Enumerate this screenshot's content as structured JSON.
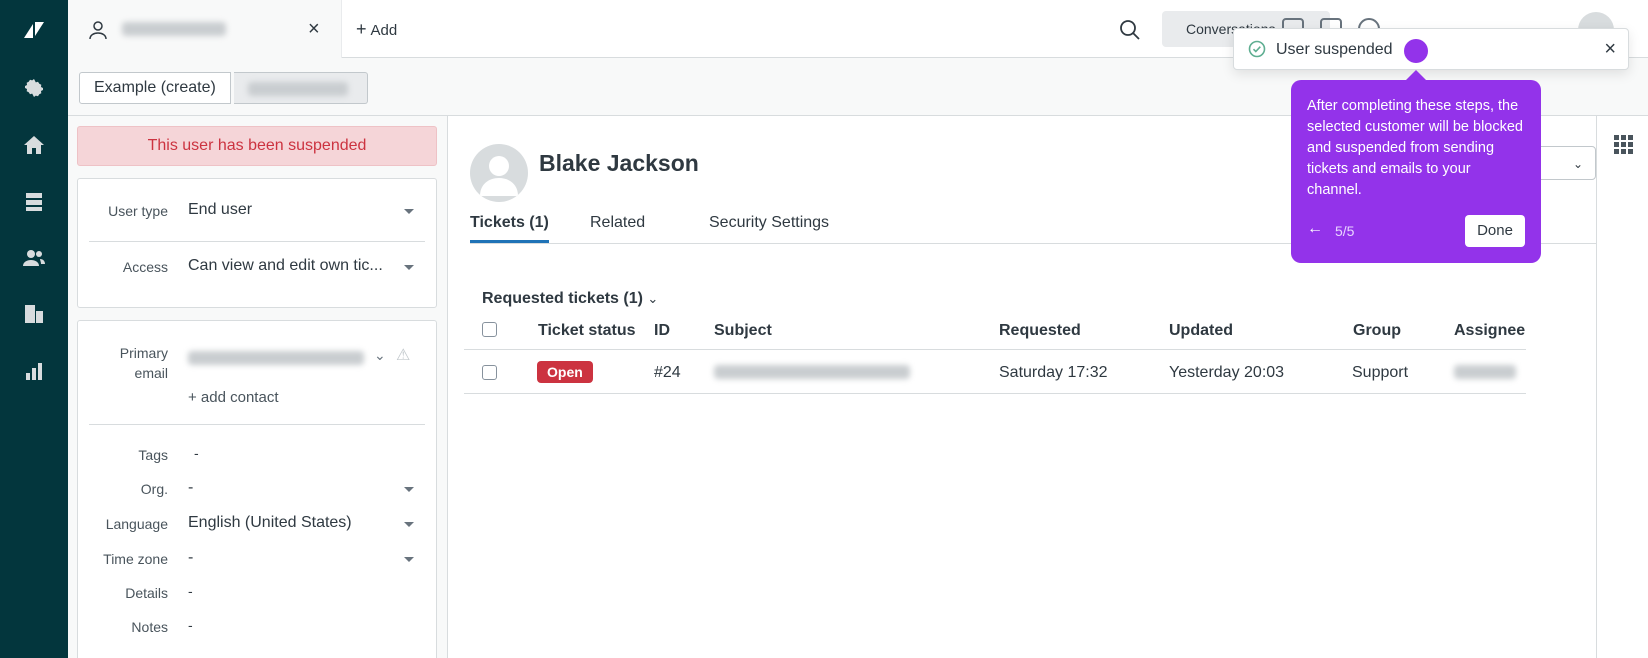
{
  "topbar": {
    "add_label": "Add",
    "conversations_label": "Conversations"
  },
  "breadcrumb": {
    "first": "Example (create)"
  },
  "banner": {
    "text": "This user has been suspended"
  },
  "fields": {
    "user_type_label": "User type",
    "user_type_value": "End user",
    "access_label": "Access",
    "access_value": "Can view and edit own tic...",
    "primary_label": "Primary",
    "email_label": "email",
    "add_contact": "+ add contact",
    "tags_label": "Tags",
    "tags_value": "-",
    "org_label": "Org.",
    "org_value": "-",
    "language_label": "Language",
    "language_value": "English (United States)",
    "timezone_label": "Time zone",
    "timezone_value": "-",
    "details_label": "Details",
    "details_value": "-",
    "notes_label": "Notes",
    "notes_value": "-"
  },
  "profile": {
    "name": "Blake Jackson"
  },
  "tabs": [
    {
      "label": "Tickets (1)"
    },
    {
      "label": "Related"
    },
    {
      "label": "Security Settings"
    }
  ],
  "tickets": {
    "section_title": "Requested tickets (1)",
    "columns": [
      "Ticket status",
      "ID",
      "Subject",
      "Requested",
      "Updated",
      "Group",
      "Assignee"
    ],
    "rows": [
      {
        "status": "Open",
        "id": "#24",
        "requested": "Saturday 17:32",
        "updated": "Yesterday 20:03",
        "group": "Support"
      }
    ]
  },
  "toast": {
    "message": "User suspended"
  },
  "tooltip": {
    "text": "After completing these steps, the selected customer will be blocked and suspended from sending tickets and emails to your channel.",
    "back": "←",
    "step": "5/5",
    "done": "Done"
  },
  "colors": {
    "rail": "#03363d",
    "accent_purple": "#9333ea",
    "danger": "#cc3340",
    "link_blue": "#1f73b7"
  },
  "icons": [
    "zendesk-logo-icon",
    "gear-icon",
    "home-icon",
    "views-icon",
    "customers-icon",
    "organizations-icon",
    "reporting-icon"
  ]
}
